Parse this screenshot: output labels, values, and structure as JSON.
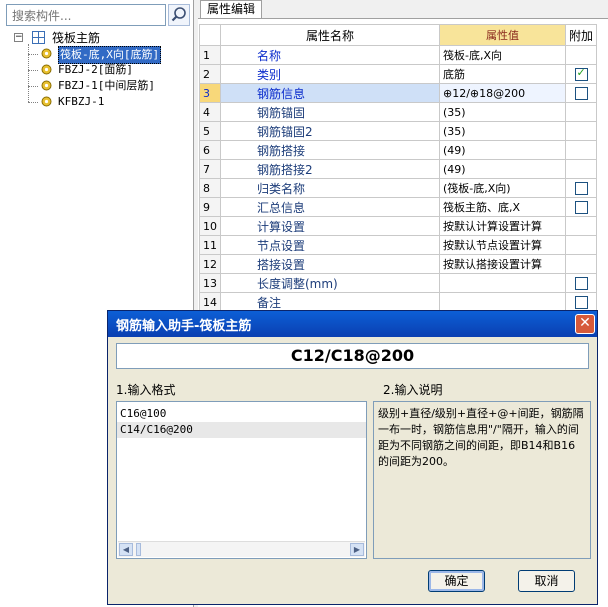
{
  "search": {
    "placeholder": "搜索构件..."
  },
  "tree": {
    "root": "筏板主筋",
    "children": [
      "筏板-底,X向[底筋]",
      "FBZJ-2[面筋]",
      "FBZJ-1[中间层筋]",
      "KFBZJ-1"
    ]
  },
  "tab": {
    "label": "属性编辑"
  },
  "grid": {
    "headers": {
      "name": "属性名称",
      "value": "属性值",
      "add": "附加"
    },
    "rows": [
      {
        "no": "1",
        "name": "名称",
        "value": "筏板-底,X向",
        "check": "none"
      },
      {
        "no": "2",
        "name": "类别",
        "value": "底筋",
        "check": "on"
      },
      {
        "no": "3",
        "name": "钢筋信息",
        "value": "⊕12/⊕18@200",
        "check": "off"
      },
      {
        "no": "4",
        "name": "钢筋锚固",
        "value": "(35)",
        "check": "none"
      },
      {
        "no": "5",
        "name": "钢筋锚固2",
        "value": "(35)",
        "check": "none"
      },
      {
        "no": "6",
        "name": "钢筋搭接",
        "value": "(49)",
        "check": "none"
      },
      {
        "no": "7",
        "name": "钢筋搭接2",
        "value": "(49)",
        "check": "none"
      },
      {
        "no": "8",
        "name": "归类名称",
        "value": "(筏板-底,X向)",
        "check": "off"
      },
      {
        "no": "9",
        "name": "汇总信息",
        "value": "筏板主筋、底,X",
        "check": "off"
      },
      {
        "no": "10",
        "name": "计算设置",
        "value": "按默认计算设置计算",
        "check": "none"
      },
      {
        "no": "11",
        "name": "节点设置",
        "value": "按默认节点设置计算",
        "check": "none"
      },
      {
        "no": "12",
        "name": "搭接设置",
        "value": "按默认搭接设置计算",
        "check": "none"
      },
      {
        "no": "13",
        "name": "长度调整(mm)",
        "value": "",
        "check": "off"
      },
      {
        "no": "14",
        "name": "备注",
        "value": "",
        "check": "off"
      }
    ]
  },
  "dialog": {
    "title": "钢筋输入助手-筏板主筋",
    "formula": "C12/C18@200",
    "format_label": "1.输入格式",
    "desc_label": "2.输入说明",
    "formats": [
      "C16@100",
      "C14/C16@200"
    ],
    "description": "级别+直径/级别+直径+@+间距，钢筋隔一布一时，钢筋信息用\"/\"隔开，输入的间距为不同钢筋之间的间距，即B14和B16的间距为200。",
    "ok": "确定",
    "cancel": "取消"
  },
  "colors": {
    "titlebar": "#0a3fb1",
    "selection": "#316ac5",
    "header_value_bg": "#f8e49a"
  }
}
